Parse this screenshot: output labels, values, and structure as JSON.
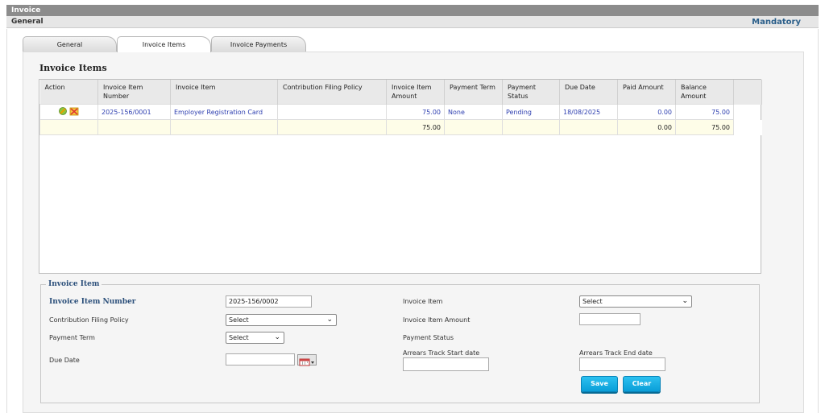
{
  "window": {
    "title": "Invoice"
  },
  "subbar": {
    "left": "General",
    "right": "Mandatory"
  },
  "tabs": [
    {
      "label": "General"
    },
    {
      "label": "Invoice Items"
    },
    {
      "label": "Invoice Payments"
    }
  ],
  "section": {
    "title": "Invoice Items"
  },
  "grid": {
    "headers": [
      "Action",
      "Invoice Item Number",
      "Invoice Item",
      "Contribution Filing Policy",
      "Invoice Item Amount",
      "Payment Term",
      "Payment Status",
      "Due Date",
      "Paid Amount",
      "Balance Amount"
    ],
    "rows": [
      {
        "number": "2025-156/0001",
        "item": "Employer Registration Card",
        "policy": "",
        "amount": "75.00",
        "term": "None",
        "status": "Pending",
        "due": "18/08/2025",
        "paid": "0.00",
        "balance": "75.00"
      }
    ],
    "totals": {
      "amount": "75.00",
      "paid": "0.00",
      "balance": "75.00"
    }
  },
  "form": {
    "legend": "Invoice Item",
    "item_number_label": "Invoice Item Number",
    "item_number_value": "2025-156/0002",
    "policy_label": "Contribution Filing Policy",
    "policy_value": "Select",
    "term_label": "Payment Term",
    "term_value": "Select",
    "due_label": "Due Date",
    "due_value": "",
    "item_label": "Invoice Item",
    "item_value": "Select",
    "amount_label": "Invoice Item Amount",
    "amount_value": "",
    "status_label": "Payment Status",
    "arrears_start_label": "Arrears Track Start date",
    "arrears_start_value": "",
    "arrears_end_label": "Arrears Track End date",
    "arrears_end_value": "",
    "save_label": "Save",
    "clear_label": "Clear"
  },
  "icons": {
    "edit": "edit-icon",
    "delete": "delete-icon",
    "calendar": "calendar-icon",
    "chevron": "chevron-down-icon"
  }
}
